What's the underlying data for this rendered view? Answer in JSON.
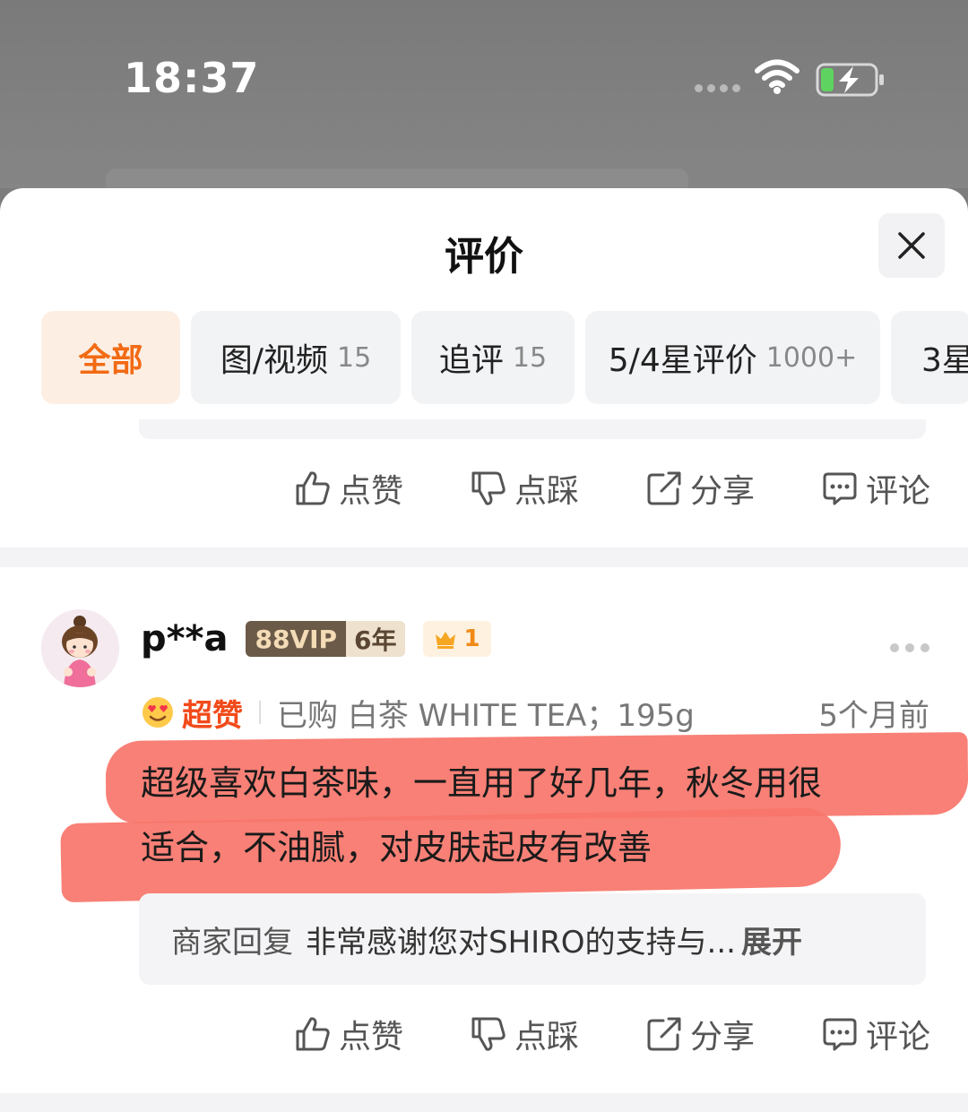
{
  "status_bar": {
    "time": "18:37"
  },
  "sheet": {
    "title": "评价"
  },
  "filters": [
    {
      "label": "全部",
      "count": ""
    },
    {
      "label": "图/视频",
      "count": "15"
    },
    {
      "label": "追评",
      "count": "15"
    },
    {
      "label": "5/4星评价",
      "count": "1000+"
    },
    {
      "label": "3星",
      "count": ""
    }
  ],
  "actions": {
    "like": "点赞",
    "dislike": "点踩",
    "share": "分享",
    "comment": "评论"
  },
  "review": {
    "username": "p**a",
    "vip_label": "88VIP",
    "vip_years": "6年",
    "crown_level": "1",
    "rating_label": "超赞",
    "purchase_info": "已购 白茶 WHITE TEA；195g",
    "time_ago": "5个月前",
    "text_line1": "超级喜欢白茶味，一直用了好几年，秋冬用很",
    "text_line2": "适合，不油腻，对皮肤起皮有改善",
    "merchant_reply_label": "商家回复",
    "merchant_reply_text": "非常感谢您对SHIRO的支持与...",
    "expand_label": "展开"
  },
  "colors": {
    "accent": "#f26a13",
    "highlight": "#f7756a",
    "rating": "#f24a1a"
  }
}
